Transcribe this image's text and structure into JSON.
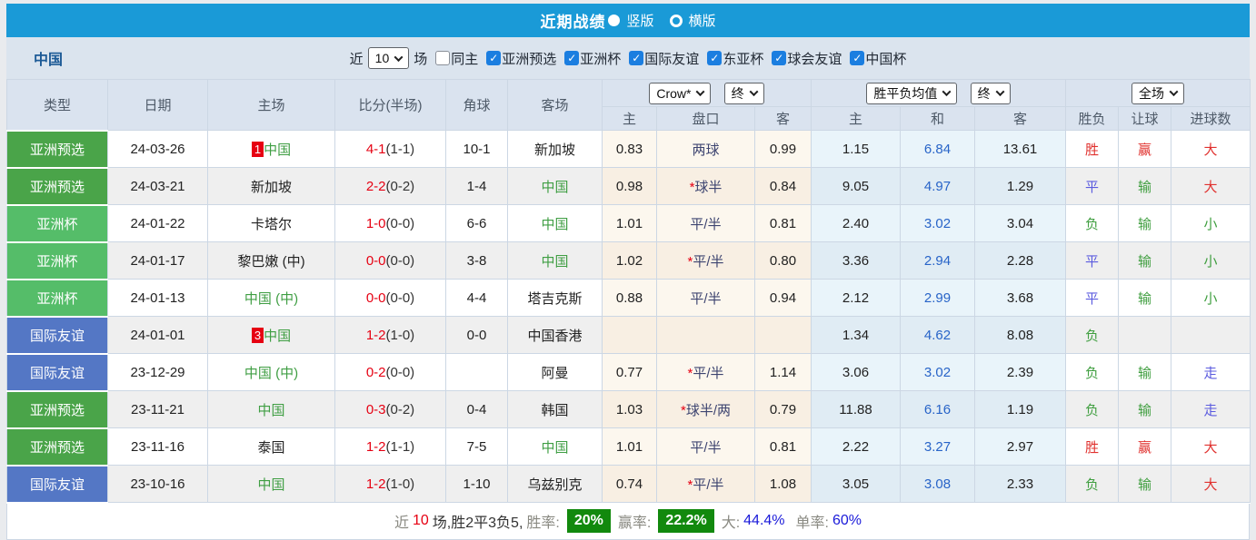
{
  "title_bar": {
    "title": "近期战绩",
    "vertical_label": "竖版",
    "horizontal_label": "横版",
    "selected_layout": "竖版"
  },
  "filter_bar": {
    "team": "中国",
    "recent_label": "近",
    "recent_count": "10",
    "unit_label": "场",
    "items": [
      {
        "label": "同主",
        "checked": false
      },
      {
        "label": "亚洲预选",
        "checked": true
      },
      {
        "label": "亚洲杯",
        "checked": true
      },
      {
        "label": "国际友谊",
        "checked": true
      },
      {
        "label": "东亚杯",
        "checked": true
      },
      {
        "label": "球会友谊",
        "checked": true
      },
      {
        "label": "中国杯",
        "checked": true
      }
    ]
  },
  "table": {
    "headers": {
      "type": "类型",
      "date": "日期",
      "home": "主场",
      "score": "比分(半场)",
      "corner": "角球",
      "away": "客场",
      "odds_home": "主",
      "odds_pan": "盘口",
      "odds_away": "客",
      "mean_home": "主",
      "mean_draw": "和",
      "mean_away": "客",
      "outcome": "胜负",
      "handicap_result": "让球",
      "goals_result": "进球数"
    },
    "selects": {
      "odds_company": "Crow*",
      "odds_period": "终",
      "mean_company": "胜平负均值",
      "mean_period": "终",
      "scope": "全场"
    },
    "type_colors": {
      "亚洲预选": "#4aa449",
      "亚洲杯": "#55bd69",
      "国际友谊": "#5477c5"
    },
    "rows": [
      {
        "type": "亚洲预选",
        "date": "24-03-26",
        "home": {
          "badge": "1",
          "name": "中国",
          "self": true
        },
        "score": "4-1",
        "half": "(1-1)",
        "corner": "10-1",
        "away": {
          "name": "新加坡",
          "self": false
        },
        "odds": {
          "home": "0.83",
          "star": false,
          "pan": "两球",
          "away": "0.99"
        },
        "mean": {
          "home": "1.15",
          "draw": "6.84",
          "away": "13.61"
        },
        "results": {
          "outcome": {
            "t": "胜",
            "c": "red"
          },
          "handicap": {
            "t": "赢",
            "c": "red"
          },
          "goals": {
            "t": "大",
            "c": "red"
          }
        }
      },
      {
        "type": "亚洲预选",
        "date": "24-03-21",
        "home": {
          "badge": "",
          "name": "新加坡",
          "self": false
        },
        "score": "2-2",
        "half": "(0-2)",
        "corner": "1-4",
        "away": {
          "name": "中国",
          "self": true
        },
        "odds": {
          "home": "0.98",
          "star": true,
          "pan": "球半",
          "away": "0.84"
        },
        "mean": {
          "home": "9.05",
          "draw": "4.97",
          "away": "1.29"
        },
        "results": {
          "outcome": {
            "t": "平",
            "c": "blue"
          },
          "handicap": {
            "t": "输",
            "c": "green"
          },
          "goals": {
            "t": "大",
            "c": "red"
          }
        }
      },
      {
        "type": "亚洲杯",
        "date": "24-01-22",
        "home": {
          "badge": "",
          "name": "卡塔尔",
          "self": false
        },
        "score": "1-0",
        "half": "(0-0)",
        "corner": "6-6",
        "away": {
          "name": "中国",
          "self": true
        },
        "odds": {
          "home": "1.01",
          "star": false,
          "pan": "平/半",
          "away": "0.81"
        },
        "mean": {
          "home": "2.40",
          "draw": "3.02",
          "away": "3.04"
        },
        "results": {
          "outcome": {
            "t": "负",
            "c": "green"
          },
          "handicap": {
            "t": "输",
            "c": "green"
          },
          "goals": {
            "t": "小",
            "c": "green"
          }
        }
      },
      {
        "type": "亚洲杯",
        "date": "24-01-17",
        "home": {
          "badge": "",
          "name": "黎巴嫩 (中)",
          "self": false
        },
        "score": "0-0",
        "half": "(0-0)",
        "corner": "3-8",
        "away": {
          "name": "中国",
          "self": true
        },
        "odds": {
          "home": "1.02",
          "star": true,
          "pan": "平/半",
          "away": "0.80"
        },
        "mean": {
          "home": "3.36",
          "draw": "2.94",
          "away": "2.28"
        },
        "results": {
          "outcome": {
            "t": "平",
            "c": "blue"
          },
          "handicap": {
            "t": "输",
            "c": "green"
          },
          "goals": {
            "t": "小",
            "c": "green"
          }
        }
      },
      {
        "type": "亚洲杯",
        "date": "24-01-13",
        "home": {
          "badge": "",
          "name": "中国 (中)",
          "self": true
        },
        "score": "0-0",
        "half": "(0-0)",
        "corner": "4-4",
        "away": {
          "name": "塔吉克斯",
          "self": false
        },
        "odds": {
          "home": "0.88",
          "star": false,
          "pan": "平/半",
          "away": "0.94"
        },
        "mean": {
          "home": "2.12",
          "draw": "2.99",
          "away": "3.68"
        },
        "results": {
          "outcome": {
            "t": "平",
            "c": "blue"
          },
          "handicap": {
            "t": "输",
            "c": "green"
          },
          "goals": {
            "t": "小",
            "c": "green"
          }
        }
      },
      {
        "type": "国际友谊",
        "date": "24-01-01",
        "home": {
          "badge": "3",
          "name": "中国",
          "self": true
        },
        "score": "1-2",
        "half": "(1-0)",
        "corner": "0-0",
        "away": {
          "name": "中国香港",
          "self": false
        },
        "odds": {
          "home": "",
          "star": false,
          "pan": "",
          "away": ""
        },
        "mean": {
          "home": "1.34",
          "draw": "4.62",
          "away": "8.08"
        },
        "results": {
          "outcome": {
            "t": "负",
            "c": "green"
          },
          "handicap": {
            "t": "",
            "c": "none"
          },
          "goals": {
            "t": "",
            "c": "none"
          }
        }
      },
      {
        "type": "国际友谊",
        "date": "23-12-29",
        "home": {
          "badge": "",
          "name": "中国 (中)",
          "self": true
        },
        "score": "0-2",
        "half": "(0-0)",
        "corner": "",
        "away": {
          "name": "阿曼",
          "self": false
        },
        "odds": {
          "home": "0.77",
          "star": true,
          "pan": "平/半",
          "away": "1.14"
        },
        "mean": {
          "home": "3.06",
          "draw": "3.02",
          "away": "2.39"
        },
        "results": {
          "outcome": {
            "t": "负",
            "c": "green"
          },
          "handicap": {
            "t": "输",
            "c": "green"
          },
          "goals": {
            "t": "走",
            "c": "blue"
          }
        }
      },
      {
        "type": "亚洲预选",
        "date": "23-11-21",
        "home": {
          "badge": "",
          "name": "中国",
          "self": true
        },
        "score": "0-3",
        "half": "(0-2)",
        "corner": "0-4",
        "away": {
          "name": "韩国",
          "self": false
        },
        "odds": {
          "home": "1.03",
          "star": true,
          "pan": "球半/两",
          "away": "0.79"
        },
        "mean": {
          "home": "11.88",
          "draw": "6.16",
          "away": "1.19"
        },
        "results": {
          "outcome": {
            "t": "负",
            "c": "green"
          },
          "handicap": {
            "t": "输",
            "c": "green"
          },
          "goals": {
            "t": "走",
            "c": "blue"
          }
        }
      },
      {
        "type": "亚洲预选",
        "date": "23-11-16",
        "home": {
          "badge": "",
          "name": "泰国",
          "self": false
        },
        "score": "1-2",
        "half": "(1-1)",
        "corner": "7-5",
        "away": {
          "name": "中国",
          "self": true
        },
        "odds": {
          "home": "1.01",
          "star": false,
          "pan": "平/半",
          "away": "0.81"
        },
        "mean": {
          "home": "2.22",
          "draw": "3.27",
          "away": "2.97"
        },
        "results": {
          "outcome": {
            "t": "胜",
            "c": "red"
          },
          "handicap": {
            "t": "赢",
            "c": "red"
          },
          "goals": {
            "t": "大",
            "c": "red"
          }
        }
      },
      {
        "type": "国际友谊",
        "date": "23-10-16",
        "home": {
          "badge": "",
          "name": "中国",
          "self": true
        },
        "score": "1-2",
        "half": "(1-0)",
        "corner": "1-10",
        "away": {
          "name": "乌兹别克",
          "self": false
        },
        "odds": {
          "home": "0.74",
          "star": true,
          "pan": "平/半",
          "away": "1.08"
        },
        "mean": {
          "home": "3.05",
          "draw": "3.08",
          "away": "2.33"
        },
        "results": {
          "outcome": {
            "t": "负",
            "c": "green"
          },
          "handicap": {
            "t": "输",
            "c": "green"
          },
          "goals": {
            "t": "大",
            "c": "red"
          }
        }
      }
    ]
  },
  "summary": {
    "prefix": "近",
    "count": "10",
    "record": "场,胜2平3负5,",
    "rate_label": "胜率:",
    "rate_value": "20%",
    "win_label": "赢率:",
    "win_value": "22.2%",
    "big_label": "大:",
    "big_value": "44.4%",
    "single_label": "单率:",
    "single_value": "60%"
  },
  "colors": {
    "accent_blue": "#1a9ad7",
    "win_red": "#e0312e",
    "draw_blue": "#5b5bdf",
    "loss_green": "#3f9e3f",
    "self_team_green": "#3f9e43",
    "score_red": "#e60012",
    "link_blue": "#2864c8",
    "summary_green": "#12890d",
    "checkbox_blue": "#1b7ee0"
  }
}
